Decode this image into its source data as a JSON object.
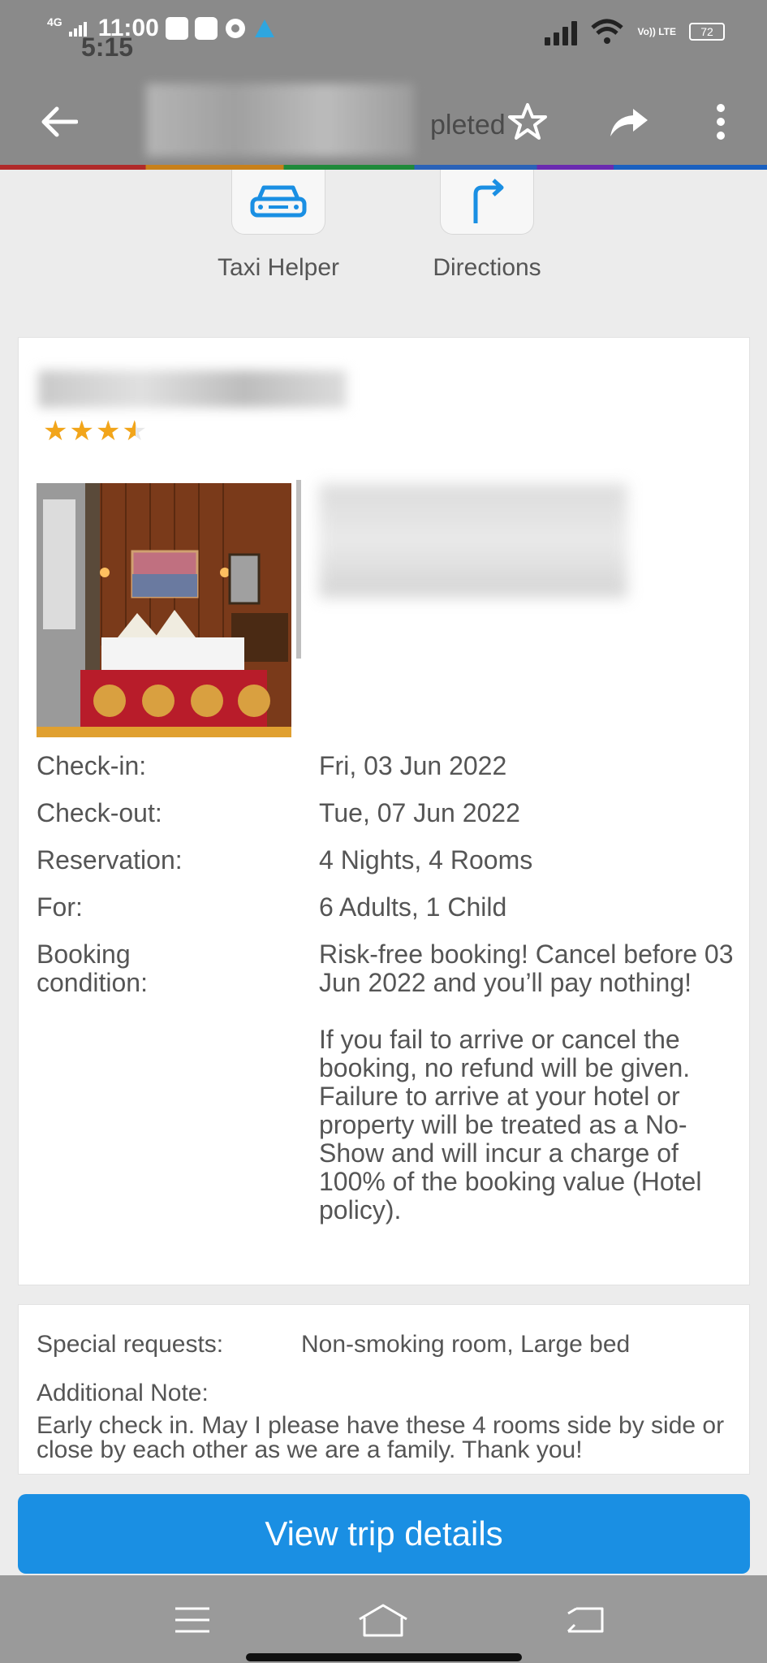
{
  "status_bar": {
    "network": "4G",
    "time": "11:00",
    "overlay_time": "5:15",
    "battery": "72",
    "lte": "Vo)) LTE"
  },
  "app_bar": {
    "title_partial": "pleted"
  },
  "quick_actions": [
    {
      "label": "Taxi Helper",
      "icon": "taxi-icon"
    },
    {
      "label": "Directions",
      "icon": "directions-icon"
    }
  ],
  "hotel": {
    "rating_stars": 3.5,
    "star_glyphs": "★★★★"
  },
  "booking": {
    "rows": [
      {
        "key": "Check-in:",
        "value": "Fri, 03 Jun 2022"
      },
      {
        "key": "Check-out:",
        "value": "Tue, 07 Jun 2022"
      },
      {
        "key": "Reservation:",
        "value": "4 Nights, 4 Rooms"
      },
      {
        "key": "For:",
        "value": "6 Adults, 1 Child"
      }
    ],
    "condition_key": "Booking condition:",
    "condition_p1": "Risk-free booking! Cancel before 03 Jun 2022 and you’ll pay nothing!",
    "condition_p2": "If you fail to arrive or cancel the booking, no refund will be given. Failure to arrive at your hotel or property will be treated as a No-Show and will incur a charge of 100% of the booking value (Hotel policy)."
  },
  "requests": {
    "special_key": "Special requests:",
    "special_value": "Non-smoking room, Large bed",
    "note_key": "Additional Note:",
    "note_value": "Early check in. May I please have these 4 rooms side by side or close by each other as we are a family. Thank you!"
  },
  "cta": {
    "label": "View trip details"
  },
  "colors": {
    "accent": "#1a8fe3",
    "star": "#f2a51a"
  }
}
